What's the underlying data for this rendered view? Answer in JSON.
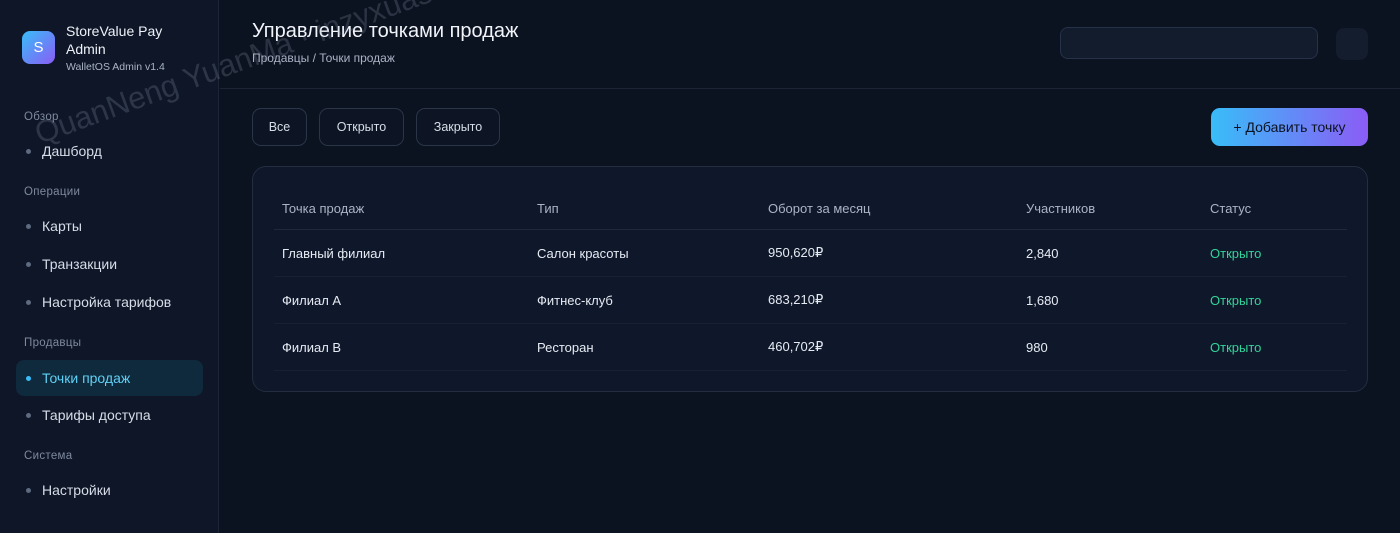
{
  "brand": {
    "logo_letter": "S",
    "title": "StoreValue Pay Admin",
    "subtitle": "WalletOS Admin v1.4"
  },
  "sidebar": {
    "sections": [
      "Обзор",
      "Операции",
      "Продавцы",
      "Система"
    ],
    "items": [
      {
        "label": "Дашборд",
        "section": "Обзор"
      },
      {
        "label": "Карты",
        "section": "Операции"
      },
      {
        "label": "Транзакции",
        "section": "Операции"
      },
      {
        "label": "Настройка тарифов",
        "section": "Операции"
      },
      {
        "label": "Точки продаж",
        "section": "Продавцы",
        "active": true
      },
      {
        "label": "Тарифы доступа",
        "section": "Продавцы"
      },
      {
        "label": "Настройки",
        "section": "Система"
      }
    ]
  },
  "header": {
    "title": "Управление точками продаж",
    "breadcrumb": "Продавцы / Точки продаж"
  },
  "filters": [
    "Все",
    "Открыто",
    "Закрыто"
  ],
  "add_button": "+ Добавить точку",
  "table": {
    "columns": [
      "Точка продаж",
      "Тип",
      "Оборот за месяц",
      "Участников",
      "Статус"
    ],
    "rows": [
      [
        "Главный филиал",
        "Салон красоты",
        "950,620₽",
        "2,840",
        "Открыто"
      ],
      [
        "Филиал A",
        "Фитнес-клуб",
        "683,210₽",
        "1,680",
        "Открыто"
      ],
      [
        "Филиал B",
        "Ресторан",
        "460,702₽",
        "980",
        "Открыто"
      ]
    ]
  },
  "watermark": "QuanNeng YuanMa · inzyxuashop.com",
  "colors": {
    "accent": "#38bdf8",
    "accent2": "#8b5cf6",
    "status_open": "#34d399",
    "background": "#0b1220"
  }
}
